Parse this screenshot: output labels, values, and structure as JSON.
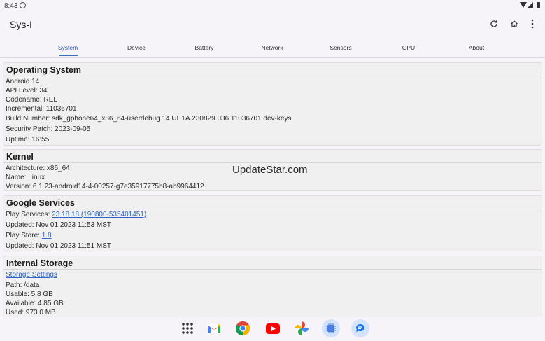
{
  "status_bar": {
    "time": "8:43"
  },
  "app": {
    "title": "Sys-I"
  },
  "tabs": [
    "System",
    "Device",
    "Battery",
    "Network",
    "Sensors",
    "GPU",
    "About"
  ],
  "sections": {
    "os": {
      "title": "Operating System",
      "rows": [
        "Android 14",
        "API Level: 34",
        "Codename: REL",
        "Incremental: 11036701",
        "Build Number: sdk_gphone64_x86_64-userdebug 14 UE1A.230829.036 11036701 dev-keys",
        "Security Patch: 2023-09-05",
        "Uptime: 16:55"
      ]
    },
    "kernel": {
      "title": "Kernel",
      "rows": [
        "Architecture: x86_64",
        "Name: Linux",
        "Version: 6.1.23-android14-4-00257-g7e35917775b8-ab9964412"
      ]
    },
    "google": {
      "title": "Google Services",
      "play_services_label": "Play Services: ",
      "play_services_value": "23.18.18 (190800-535401451)",
      "play_services_updated": "Updated: Nov 01 2023 11:53 MST",
      "play_store_label": "Play Store: ",
      "play_store_value": "1.8",
      "play_store_updated": "Updated: Nov 01 2023 11:51 MST"
    },
    "storage": {
      "title": "Internal Storage",
      "settings_link": "Storage Settings",
      "rows": [
        "Path: /data",
        "Usable: 5.8 GB",
        "Available: 4.85 GB",
        "Used: 973.0 MB"
      ]
    }
  },
  "watermark": "UpdateStar.com",
  "dock": [
    "apps-grid-icon",
    "gmail-icon",
    "chrome-icon",
    "youtube-icon",
    "photos-icon",
    "sys-i-app-icon",
    "messages-icon"
  ],
  "colors": {
    "accent": "#3d6fc4",
    "link": "#2f65c2",
    "background": "#f7f4f9"
  }
}
